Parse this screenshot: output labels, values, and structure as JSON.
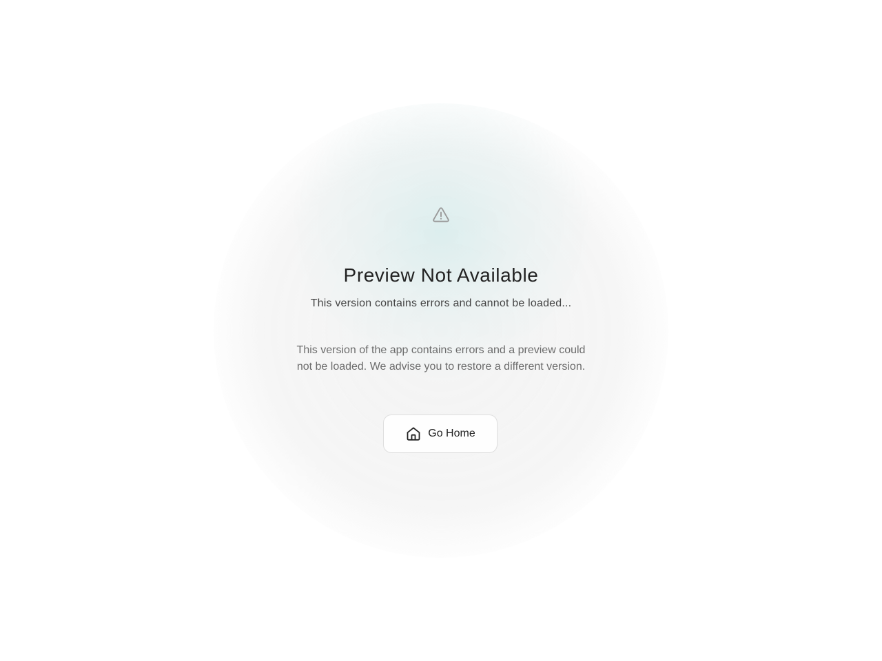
{
  "main": {
    "icon": "warning-triangle-icon",
    "title": "Preview Not Available",
    "subtitle": "This version contains errors and cannot be loaded...",
    "description": "This version of the app contains errors and a preview could not be loaded. We advise you to restore a different version.",
    "button": {
      "icon": "home-icon",
      "label": "Go Home"
    }
  },
  "colors": {
    "title": "#222222",
    "subtitle": "#444444",
    "description": "#6b6b6b",
    "icon": "#9a9a9a",
    "glow_accent": "#e3f1f1",
    "button_border": "#dedede"
  }
}
